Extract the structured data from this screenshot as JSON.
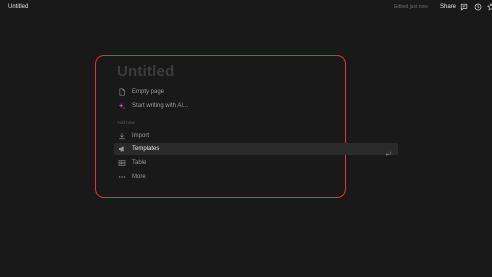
{
  "header": {
    "doc_title": "Untitled",
    "edited_status": "Edited just now",
    "share_label": "Share",
    "icons": [
      "comment-icon",
      "clock-icon",
      "star-icon"
    ]
  },
  "page": {
    "title_placeholder": "Untitled"
  },
  "quick_actions": [
    {
      "label": "Empty page",
      "icon": "document-icon"
    },
    {
      "label": "Start writing with AI...",
      "icon": "sparkle-icon"
    }
  ],
  "add_new": {
    "section_label": "Add new",
    "items": [
      {
        "label": "Import",
        "icon": "download-icon"
      },
      {
        "label": "Templates",
        "icon": "megaphone-icon",
        "selected": true
      },
      {
        "label": "Table",
        "icon": "table-icon"
      },
      {
        "label": "More",
        "icon": "ellipsis-icon"
      }
    ]
  },
  "colors": {
    "background": "#191919",
    "highlight_border": "#e0333a",
    "ai_accent": "#c84bd8",
    "selected_row": "#2a2a2a"
  }
}
